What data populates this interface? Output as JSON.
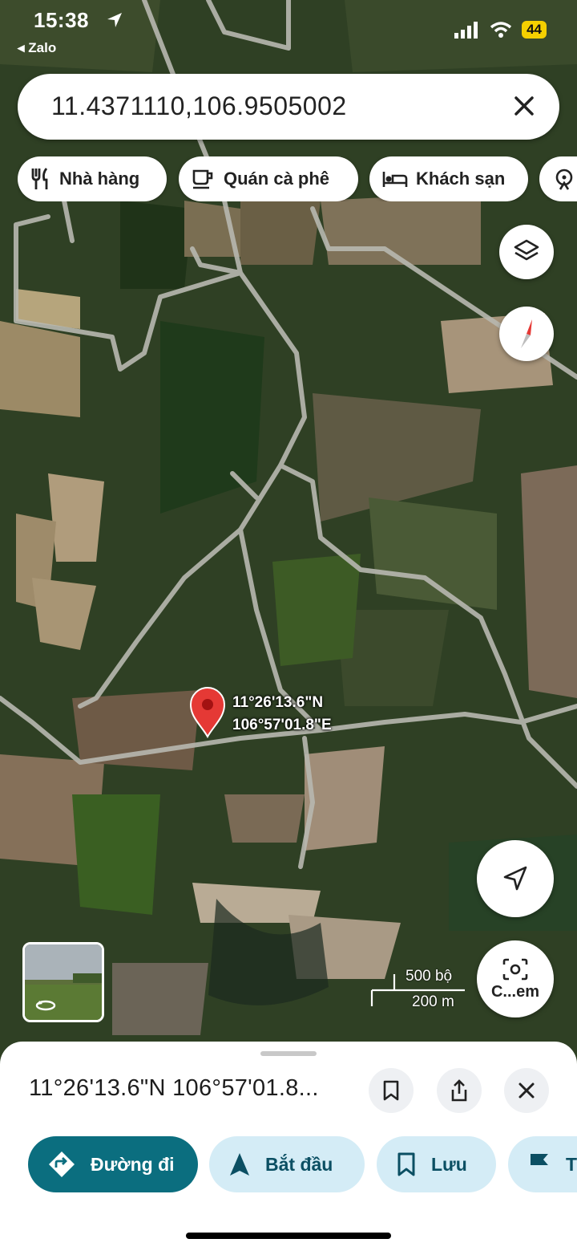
{
  "status_bar": {
    "time": "15:38",
    "back_app": "Zalo",
    "battery": "44"
  },
  "search": {
    "query": "11.4371110,106.9505002"
  },
  "chips": [
    {
      "label": "Nhà hàng",
      "icon": "fork-knife-icon"
    },
    {
      "label": "Quán cà phê",
      "icon": "coffee-cup-icon"
    },
    {
      "label": "Khách sạn",
      "icon": "bed-icon"
    },
    {
      "label": "",
      "icon": "attraction-icon"
    }
  ],
  "map": {
    "pin_lat": "11°26'13.6\"N",
    "pin_lng": "106°57'01.8\"E",
    "scale_imperial": "500 bộ",
    "scale_metric": "200 m",
    "camera_label": "C...em"
  },
  "sheet": {
    "title": "11°26'13.6\"N 106°57'01.8...",
    "actions": [
      {
        "label": "Đường đi",
        "icon": "directions-icon"
      },
      {
        "label": "Bắt đầu",
        "icon": "navigation-arrow-icon"
      },
      {
        "label": "Lưu",
        "icon": "bookmark-icon"
      },
      {
        "label": "T",
        "icon": "flag-icon"
      }
    ]
  },
  "colors": {
    "accent": "#0b6e7f",
    "pin": "#e53935",
    "chip_bg": "#d4ecf6"
  }
}
